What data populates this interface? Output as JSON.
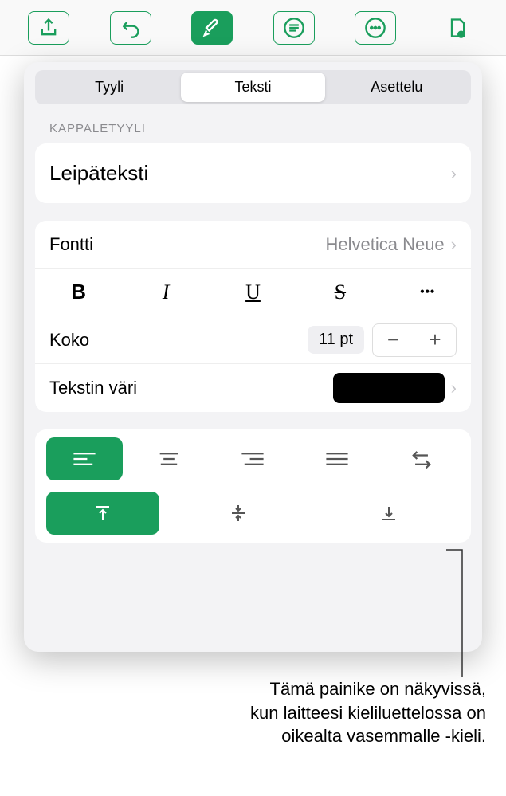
{
  "tabs": {
    "style": "Tyyli",
    "text": "Teksti",
    "layout": "Asettelu"
  },
  "section": {
    "paragraph_style_label": "KAPPALETYYLI"
  },
  "paragraph_style": {
    "name": "Leipäteksti"
  },
  "font": {
    "label": "Fontti",
    "value": "Helvetica Neue"
  },
  "size": {
    "label": "Koko",
    "value": "11 pt"
  },
  "text_color": {
    "label": "Tekstin väri"
  },
  "caption": {
    "line1": "Tämä painike on näkyvissä,",
    "line2": "kun laitteesi kieliluettelossa on",
    "line3": "oikealta vasemmalle -kieli."
  },
  "format": {
    "bold": "B",
    "italic": "I",
    "underline": "U",
    "strike": "S",
    "more": "•••"
  },
  "stepper": {
    "minus": "−",
    "plus": "+"
  }
}
